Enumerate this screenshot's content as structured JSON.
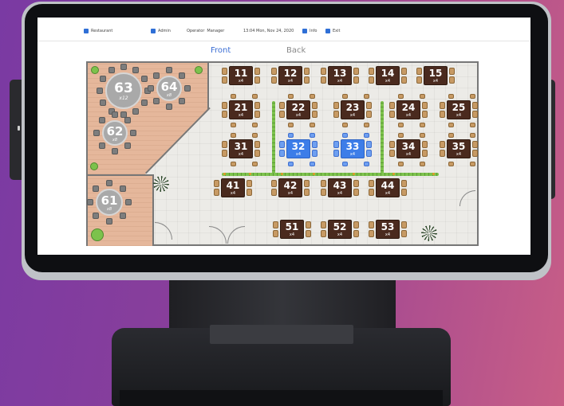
{
  "header": {
    "restaurant_label": "Restaurant",
    "admin_label": "Admin",
    "operator_label": "Operator",
    "role_label": "Manager",
    "datetime": "13:04 Mon, Nov 24, 2020",
    "info_label": "Info",
    "exit_label": "Exit"
  },
  "tabs": {
    "front": "Front",
    "back": "Back",
    "active": "Front"
  },
  "colors": {
    "accent": "#2f6fd6",
    "table": "#4a2a1e",
    "selected": "#3d7de8",
    "round_table": "#a9a9a9"
  },
  "tables": [
    {
      "num": "11",
      "cap": "x4"
    },
    {
      "num": "12",
      "cap": "x4"
    },
    {
      "num": "13",
      "cap": "x4"
    },
    {
      "num": "14",
      "cap": "x4"
    },
    {
      "num": "15",
      "cap": "x4"
    },
    {
      "num": "21",
      "cap": "x4"
    },
    {
      "num": "22",
      "cap": "x4"
    },
    {
      "num": "23",
      "cap": "x4"
    },
    {
      "num": "24",
      "cap": "x4"
    },
    {
      "num": "25",
      "cap": "x4"
    },
    {
      "num": "31",
      "cap": "x4"
    },
    {
      "num": "32",
      "cap": "x4",
      "selected": true
    },
    {
      "num": "33",
      "cap": "x4",
      "selected": true
    },
    {
      "num": "34",
      "cap": "x4"
    },
    {
      "num": "35",
      "cap": "x4"
    },
    {
      "num": "41",
      "cap": "x4"
    },
    {
      "num": "42",
      "cap": "x4"
    },
    {
      "num": "43",
      "cap": "x4"
    },
    {
      "num": "44",
      "cap": "x4"
    },
    {
      "num": "51",
      "cap": "x4"
    },
    {
      "num": "52",
      "cap": "x4"
    },
    {
      "num": "53",
      "cap": "x4"
    }
  ],
  "round_tables": [
    {
      "num": "63",
      "cap": "x12"
    },
    {
      "num": "64",
      "cap": "x8"
    },
    {
      "num": "62",
      "cap": "x8"
    },
    {
      "num": "61",
      "cap": "x8"
    }
  ]
}
